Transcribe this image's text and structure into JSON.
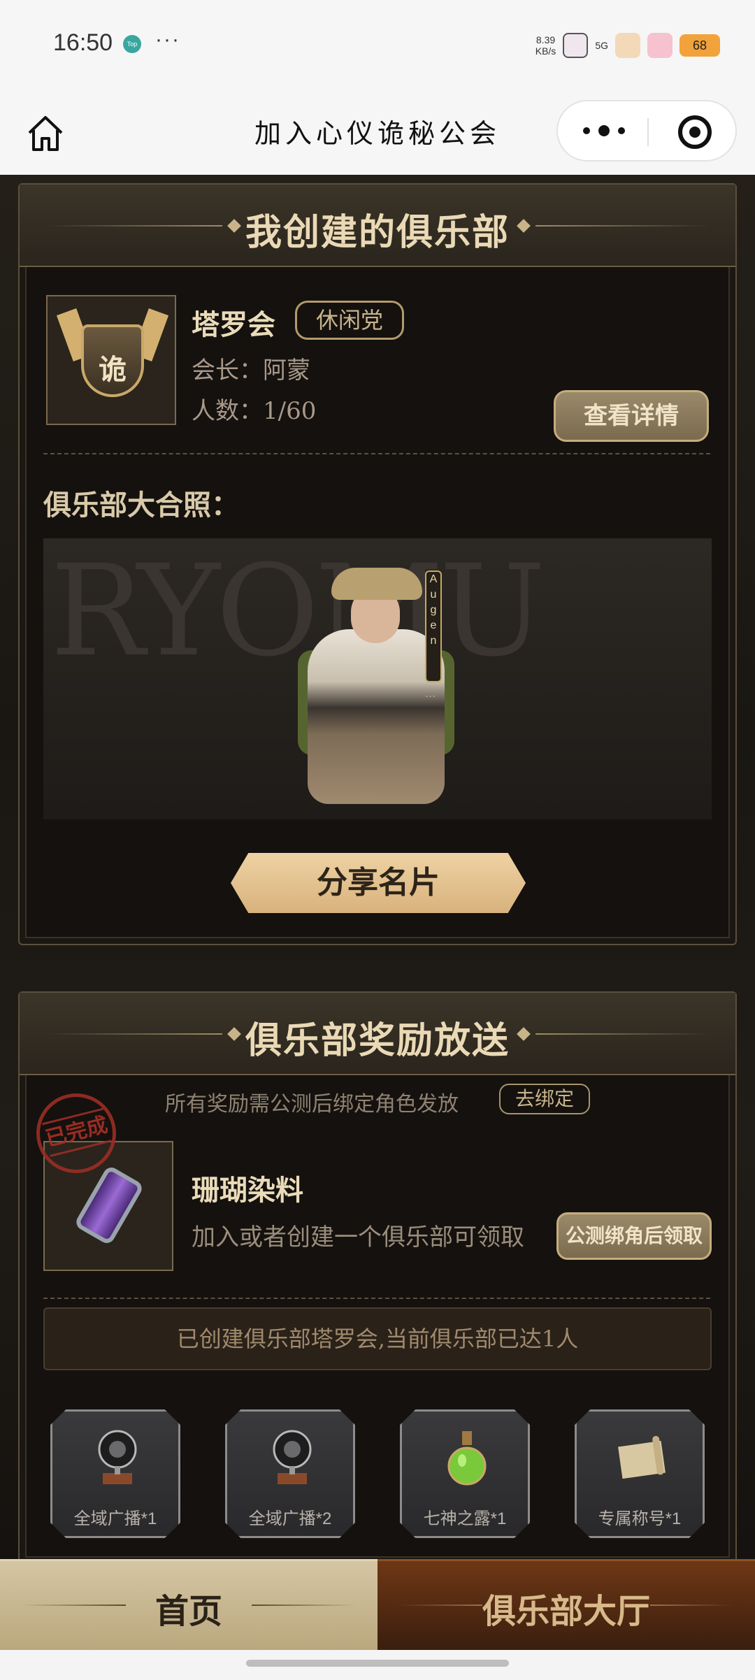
{
  "status_bar": {
    "time": "16:50",
    "app_badge": "Top",
    "dots": "···",
    "net_speed": "8.39",
    "net_unit": "KB/s",
    "signal": "5G",
    "battery": "68"
  },
  "nav": {
    "title": "加入心仪诡秘公会"
  },
  "my_club": {
    "section_title": "我创建的俱乐部",
    "emblem_char": "诡",
    "name": "塔罗会",
    "tag": "休闲党",
    "leader_line": "会长：阿蒙",
    "members_line": "人数：1/60",
    "detail_button": "查看详情",
    "photo_label": "俱乐部大合照：",
    "photo_bg_text": "RYOMU",
    "nametag_letters": [
      "A",
      "u",
      "g",
      "e",
      "n"
    ],
    "nametag_more": "...",
    "share_button": "分享名片"
  },
  "rewards": {
    "section_title": "俱乐部奖励放送",
    "notice": "所有奖励需公测后绑定角色发放",
    "bind_button": "去绑定",
    "stamp_text": "已完成",
    "reward_name": "珊瑚染料",
    "reward_desc": "加入或者创建一个俱乐部可领取",
    "claim_button": "公测绑角后领取",
    "status_text": "已创建俱乐部塔罗会,当前俱乐部已达1人",
    "items": [
      {
        "label": "全域广播*1",
        "icon": "broadcast-icon"
      },
      {
        "label": "全域广播*2",
        "icon": "broadcast-icon"
      },
      {
        "label": "七神之露*1",
        "icon": "potion-icon"
      },
      {
        "label": "专属称号*1",
        "icon": "scroll-icon"
      }
    ]
  },
  "tabs": {
    "home": "首页",
    "hall": "俱乐部大厅"
  },
  "colors": {
    "accent_gold": "#ead9b5",
    "panel_bg": "#14110e",
    "hall_tab": "#6e3715",
    "stamp_red": "#9a2d25"
  }
}
